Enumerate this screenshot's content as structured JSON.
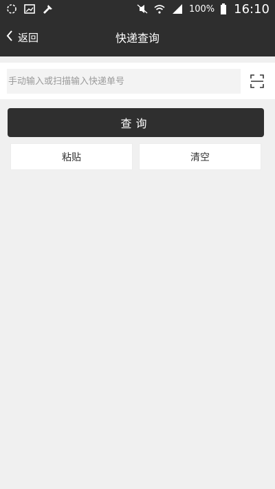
{
  "status_bar": {
    "battery_percent": "100%",
    "time": "16:10",
    "icons": [
      "loading-circle-icon",
      "image-icon",
      "tool-icon",
      "mute-icon",
      "wifi-icon",
      "signal-icon",
      "battery-icon"
    ]
  },
  "nav": {
    "back_label": "返回",
    "title": "快递查询"
  },
  "search": {
    "placeholder": "手动输入或扫描输入快递单号",
    "value": ""
  },
  "buttons": {
    "query": "查询",
    "paste": "粘贴",
    "clear": "清空"
  },
  "colors": {
    "bar": "#2e2e2e",
    "background": "#f0f0f0",
    "button_dark": "#2f2f2f"
  }
}
